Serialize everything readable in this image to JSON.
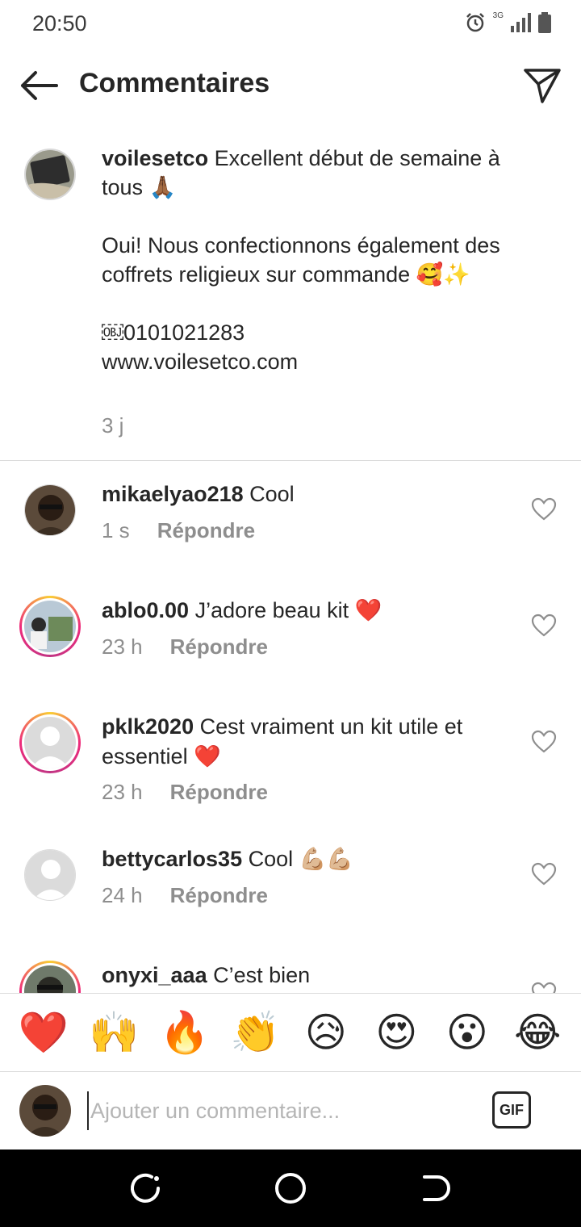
{
  "status_bar": {
    "time": "20:50",
    "network": "3G"
  },
  "header": {
    "title": "Commentaires"
  },
  "caption": {
    "username": "voilesetco",
    "text": " Excellent début de semaine à tous 🙏🏾\n\nOui! Nous confectionnons également des coffrets religieux sur commande 🥰✨\n\n￼0101021283\nwww.voilesetco.com",
    "time": "3 j"
  },
  "comments": [
    {
      "username": "mikaelyao218",
      "text": " Cool",
      "time": "1 s",
      "reply": "Répondre"
    },
    {
      "username": "ablo0.00",
      "text": " J’adore beau kit ❤️",
      "time": "23 h",
      "reply": "Répondre"
    },
    {
      "username": "pklk2020",
      "text": " Cest vraiment un kit utile et essentiel ❤️",
      "time": "23 h",
      "reply": "Répondre"
    },
    {
      "username": "bettycarlos35",
      "text": " Cool 💪🏼💪🏼",
      "time": "24 h",
      "reply": "Répondre"
    },
    {
      "username": "onyxi_aaa",
      "text": " C’est bien",
      "time": "",
      "reply": ""
    }
  ],
  "emoji_bar": [
    "❤️",
    "🙌",
    "🔥",
    "👏",
    "😥",
    "😍",
    "😮",
    "😂"
  ],
  "input": {
    "placeholder": "Ajouter un commentaire...",
    "gif_label": "GIF"
  }
}
